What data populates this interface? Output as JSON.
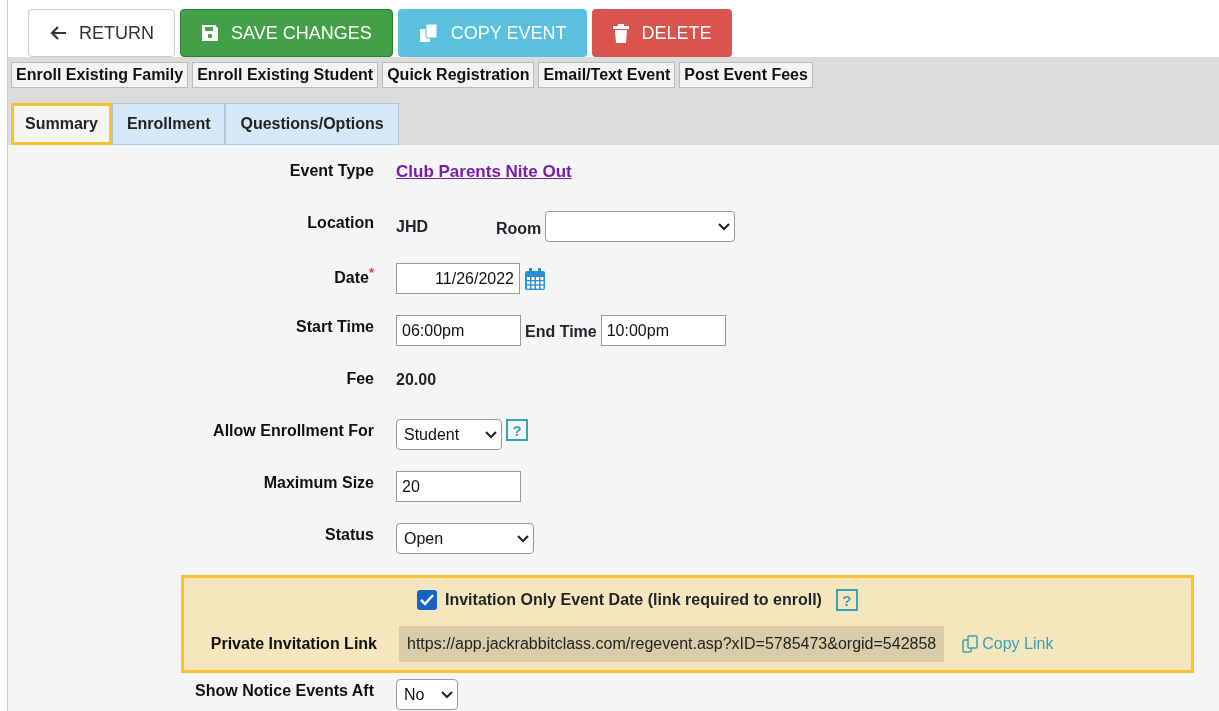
{
  "toolbar": [
    {
      "kind": "return",
      "label": "RETURN"
    },
    {
      "kind": "save",
      "label": "SAVE CHANGES"
    },
    {
      "kind": "copy",
      "label": "COPY EVENT"
    },
    {
      "kind": "delete",
      "label": "DELETE"
    }
  ],
  "actions": [
    "Enroll Existing Family",
    "Enroll Existing Student",
    "Quick Registration",
    "Email/Text Event",
    "Post Event Fees"
  ],
  "tabs": [
    {
      "label": "Summary",
      "selected": true
    },
    {
      "label": "Enrollment",
      "selected": false
    },
    {
      "label": "Questions/Options",
      "selected": false
    }
  ],
  "form": [
    {
      "kind": "link",
      "label": "Event Type",
      "value": "Club Parents Nite Out"
    },
    {
      "kind": "location",
      "label": "Location",
      "value": "JHD",
      "room_label": "Room"
    },
    {
      "kind": "date",
      "label": "Date",
      "required_mark": "*",
      "value": "11/26/2022"
    },
    {
      "kind": "times",
      "label": "Start Time",
      "value": "06:00pm",
      "end_label": "End Time",
      "end_value": "10:00pm"
    },
    {
      "kind": "text",
      "label": "Fee",
      "value": "20.00"
    },
    {
      "kind": "select",
      "label": "Allow Enrollment For",
      "value": "Student",
      "help": "?"
    },
    {
      "kind": "input",
      "label": "Maximum Size",
      "value": "20"
    },
    {
      "kind": "select",
      "label": "Status",
      "value": "Open"
    }
  ],
  "invitation": {
    "checkbox_label": "Invitation Only Event Date (link required to enroll)",
    "checked": true,
    "help": "?",
    "link_label": "Private Invitation Link",
    "link_value": "https://app.jackrabbitclass.com/regevent.asp?xID=5785473&orgid=542858",
    "copy_label": "Copy Link"
  },
  "after": {
    "label": "Show Notice Events Aft",
    "value": "No"
  }
}
